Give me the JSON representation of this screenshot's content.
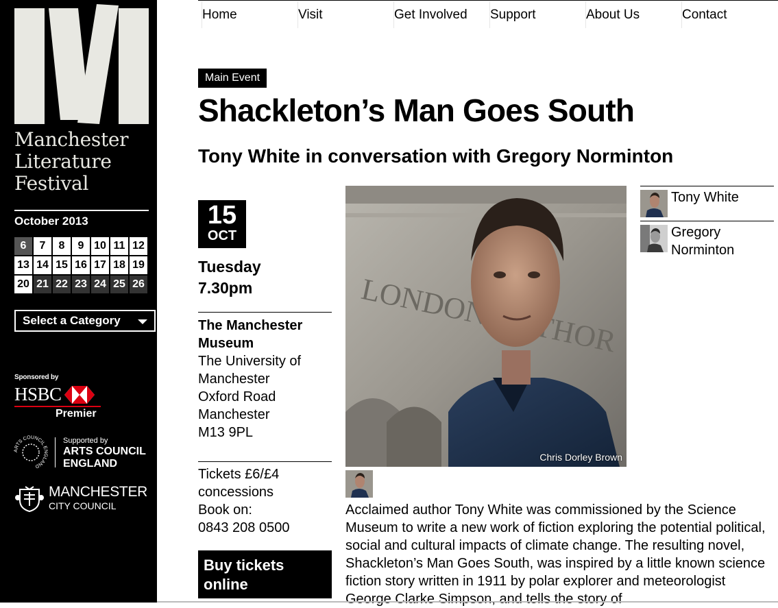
{
  "sidebar": {
    "logo_lines": [
      "Manchester",
      "Literature",
      "Festival"
    ],
    "calendar": {
      "title": "October 2013",
      "days": [
        {
          "label": "6",
          "style": "today"
        },
        {
          "label": "7",
          "style": "light"
        },
        {
          "label": "8",
          "style": "light"
        },
        {
          "label": "9",
          "style": "light"
        },
        {
          "label": "10",
          "style": "light"
        },
        {
          "label": "11",
          "style": "light"
        },
        {
          "label": "12",
          "style": "light"
        },
        {
          "label": "13",
          "style": "light"
        },
        {
          "label": "14",
          "style": "light"
        },
        {
          "label": "15",
          "style": "light"
        },
        {
          "label": "16",
          "style": "light"
        },
        {
          "label": "17",
          "style": "light"
        },
        {
          "label": "18",
          "style": "light"
        },
        {
          "label": "19",
          "style": "light"
        },
        {
          "label": "20",
          "style": "light"
        },
        {
          "label": "21",
          "style": "dark"
        },
        {
          "label": "22",
          "style": "dark"
        },
        {
          "label": "23",
          "style": "dark"
        },
        {
          "label": "24",
          "style": "dark"
        },
        {
          "label": "25",
          "style": "dark"
        },
        {
          "label": "26",
          "style": "dark"
        }
      ]
    },
    "category_select": "Select a Category",
    "sponsors": {
      "hsbc_sponsored_by": "Sponsored by",
      "hsbc_name": "HSBC",
      "hsbc_premier": "Premier",
      "ace_supported_by": "Supported by",
      "ace_line1": "ARTS COUNCIL",
      "ace_line2": "ENGLAND",
      "ace_ring_text": "ARTS COUNCIL ENGLAND",
      "mcc_line1": "MANCHESTER",
      "mcc_line2": "CITY COUNCIL"
    }
  },
  "nav": {
    "items": [
      "Home",
      "Visit",
      "Get Involved",
      "Support",
      "About Us",
      "Contact"
    ]
  },
  "event": {
    "badge": "Main Event",
    "title": "Shackleton’s Man Goes South",
    "subtitle": "Tony White in conversation with Gregory Norminton",
    "date_day": "15",
    "date_month": "OCT",
    "weekday": "Tuesday",
    "time": "7.30pm",
    "venue_name_line1": "The Manchester",
    "venue_name_line2": "Museum",
    "venue_address": [
      "The University of",
      "Manchester",
      "Oxford Road",
      "Manchester",
      "M13 9PL"
    ],
    "tickets_lines": [
      "Tickets £6/£4",
      "concessions",
      "Book on:",
      "0843 208 0500"
    ],
    "buy_button_line1": "Buy tickets",
    "buy_button_line2": "online",
    "photo_credit": "Chris Dorley Brown",
    "photo_sign_text": "LONDON AUTHOR",
    "description": "Acclaimed author Tony White was commissioned by the Science Museum to write a new work of fiction exploring the potential political, social and cultural impacts of climate change. The resulting novel, Shackleton’s Man Goes South, was inspired by a little known science fiction story written in 1911 by polar explorer and meteorologist George Clarke Simpson, and tells the story of"
  },
  "people": [
    {
      "name": "Tony White"
    },
    {
      "name": "Gregory Norminton"
    }
  ],
  "colors": {
    "sidebar_bg": "#000000",
    "hsbc_red": "#db0011",
    "calendar_dark": "#333333",
    "calendar_today": "#555555"
  }
}
